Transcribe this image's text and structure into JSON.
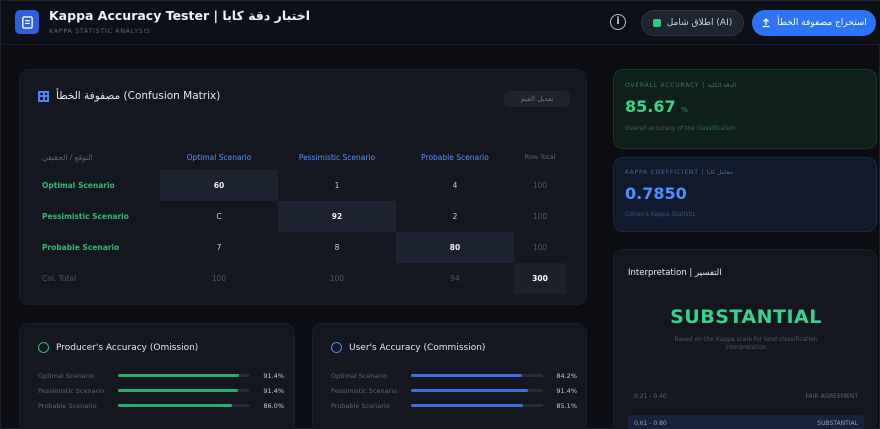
{
  "header": {
    "title": "Kappa Accuracy Tester | اختبار دقة كابا",
    "subtitle": "KAPPA STATISTIC ANALYSIS",
    "info_icon": "info-icon",
    "secondary_button": "اطلاق شامل (AI)",
    "primary_button": "استخراج مصفوفة الخطأ"
  },
  "matrix": {
    "title": "مصفوفة الخطأ (Confusion Matrix)",
    "hint": "تعديل القيم",
    "corner": "التوقع / الحقيقي",
    "columns": [
      "Optimal Scenario",
      "Pessimistic Scenario",
      "Probable Scenario",
      "Row Total"
    ],
    "rows": [
      {
        "label": "Optimal Scenario",
        "cells": [
          "60",
          "1",
          "4"
        ],
        "total": "100"
      },
      {
        "label": "Pessimistic Scenario",
        "cells": [
          "C",
          "92",
          "2"
        ],
        "total": "100"
      },
      {
        "label": "Probable Scenario",
        "cells": [
          "7",
          "8",
          "80"
        ],
        "total": "100"
      }
    ],
    "total_row": {
      "label": "Col. Total",
      "cells": [
        "100",
        "100",
        "94"
      ],
      "grand": "300"
    }
  },
  "producers": {
    "title": "Producer's Accuracy (Omission)",
    "items": [
      {
        "label": "Optimal Scenario",
        "value": 0.92,
        "text": "91.4%"
      },
      {
        "label": "Pessimistic Scenario",
        "value": 0.91,
        "text": "91.4%"
      },
      {
        "label": "Probable Scenario",
        "value": 0.86,
        "text": "86.0%"
      }
    ],
    "color": "#27ae6a"
  },
  "users": {
    "title": "User's Accuracy (Commission)",
    "items": [
      {
        "label": "Optimal Scenario",
        "value": 0.84,
        "text": "84.2%"
      },
      {
        "label": "Pessimistic Scenario",
        "value": 0.89,
        "text": "91.4%"
      },
      {
        "label": "Probable Scenario",
        "value": 0.85,
        "text": "85.1%"
      }
    ],
    "color": "#3a6fe0"
  },
  "overall": {
    "caption": "OVERALL ACCURACY | الدقة الكلية",
    "value": "85.67",
    "unit": "%",
    "note": "Overall accuracy of the classification"
  },
  "kappa": {
    "caption": "KAPPA COEFFICIENT | معامل كابا",
    "value": "0.7850",
    "note": "Cohen's Kappa Statistic"
  },
  "interpretation": {
    "title": "Interpretation | التفسير",
    "level": "SUBSTANTIAL",
    "desc": "Based on the Kappa scale for land classification interpretation",
    "scale": [
      {
        "range": "0.61 - 0.80",
        "label": "SUBSTANTIAL"
      }
    ],
    "scale_top": {
      "range": "0.21 - 0.40",
      "label": "FAIR AGREEMENT"
    }
  }
}
